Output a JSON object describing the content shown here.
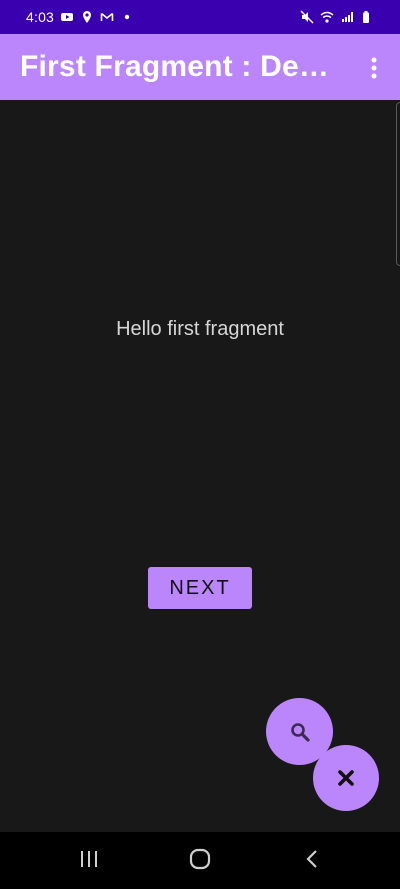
{
  "status_bar": {
    "time": "4:03",
    "left_icons": [
      "youtube-icon",
      "location-pin-icon",
      "gmail-icon",
      "dot-icon"
    ],
    "right_icons": [
      "mute-icon",
      "wifi-icon",
      "signal-icon",
      "battery-icon"
    ]
  },
  "app_bar": {
    "title": "First Fragment : Dem...",
    "overflow_icon": "more-vert-icon",
    "background_color": "#bb86fc"
  },
  "content": {
    "hello_text": "Hello first fragment",
    "next_button_label": "NEXT"
  },
  "fabs": {
    "search_icon": "search-icon",
    "close_icon": "close-icon"
  },
  "nav_bar": {
    "recents_icon": "recents-icon",
    "home_icon": "home-icon",
    "back_icon": "back-icon"
  },
  "colors": {
    "accent": "#bb86fc",
    "status_bar": "#3a00b0",
    "background": "#181818"
  }
}
